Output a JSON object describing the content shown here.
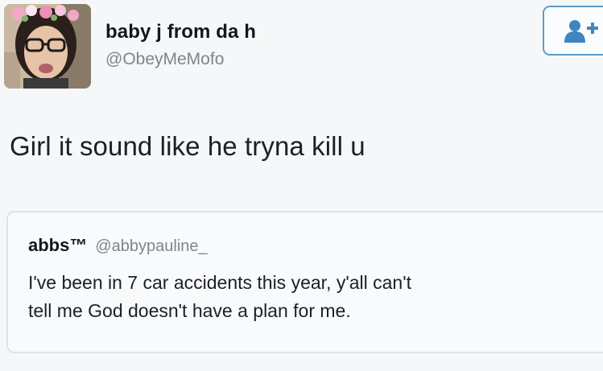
{
  "author": {
    "display_name": "baby j from da h",
    "handle": "@ObeyMeMofo",
    "avatar_icon": "user-photo-avatar"
  },
  "follow_button": {
    "icon": "add-user-icon",
    "color": "#5d9cc7"
  },
  "tweet": {
    "text": "Girl it sound like he tryna kill u"
  },
  "quoted_tweet": {
    "display_name": "abbs™",
    "handle": "@abbypauline_",
    "text_lines": [
      "I've been in 7 car accidents this year, y'all can't",
      "tell me God doesn't have a plan for me."
    ]
  },
  "colors": {
    "background": "#f6f7f8",
    "secondary_text": "#7a8690",
    "border": "#dfe3e6"
  }
}
